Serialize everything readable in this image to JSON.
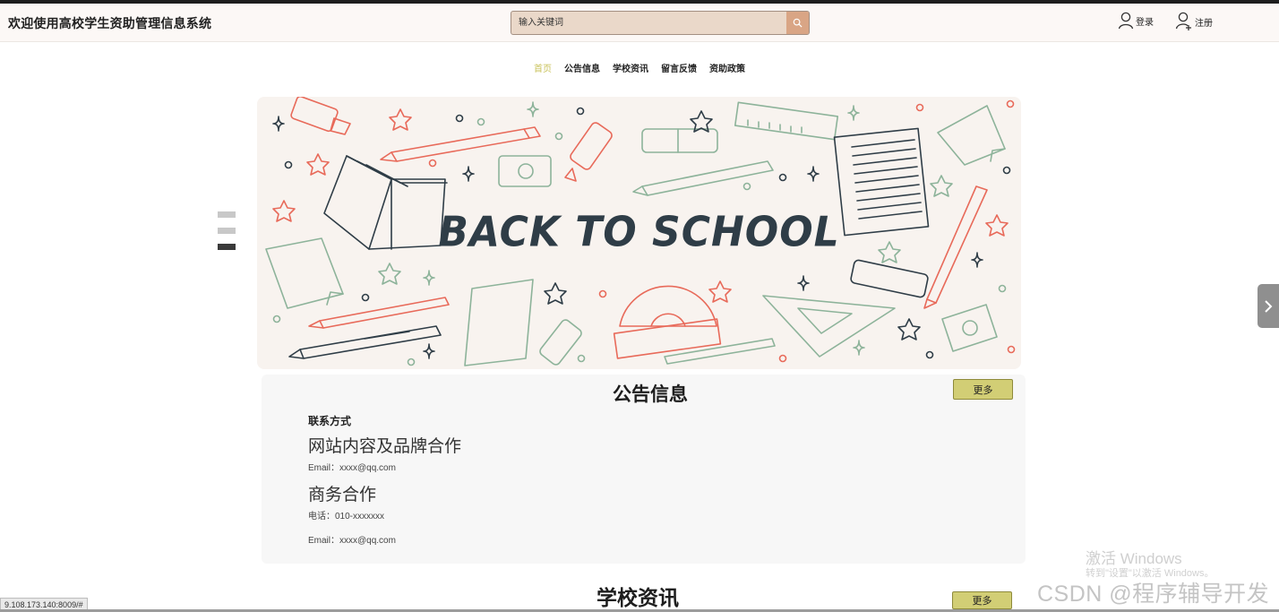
{
  "header": {
    "site_title": "欢迎使用高校学生资助管理信息系统",
    "search_placeholder": "输入关键词",
    "login_label": "登录",
    "register_label": "注册"
  },
  "nav": {
    "items": [
      "首页",
      "公告信息",
      "学校资讯",
      "留言反馈",
      "资助政策"
    ],
    "active_index": 0
  },
  "banner": {
    "title_text": "BACK TO SCHOOL",
    "active_slide": 3,
    "slide_count": 3
  },
  "notice_section": {
    "title": "公告信息",
    "more_label": "更多",
    "contact_heading": "联系方式",
    "brand_title": "网站内容及品牌合作",
    "brand_email": "Email：xxxx@qq.com",
    "business_title": "商务合作",
    "business_phone": "电话：010-xxxxxxx",
    "business_email": "Email：xxxx@qq.com"
  },
  "news_section": {
    "title": "学校资讯",
    "more_label": "更多"
  },
  "overlay": {
    "windows_activate": "激活 Windows",
    "windows_hint": "转到\"设置\"以激活 Windows。",
    "watermark": "CSDN @程序辅导开发",
    "status_url": "9.108.173.140:8009/#"
  },
  "colors": {
    "accent_olive": "#d2ce75",
    "nav_active": "#c9c25a",
    "search_bg": "#ead8c9",
    "search_button": "#d9a585",
    "banner_bg": "#f8f3ef"
  }
}
